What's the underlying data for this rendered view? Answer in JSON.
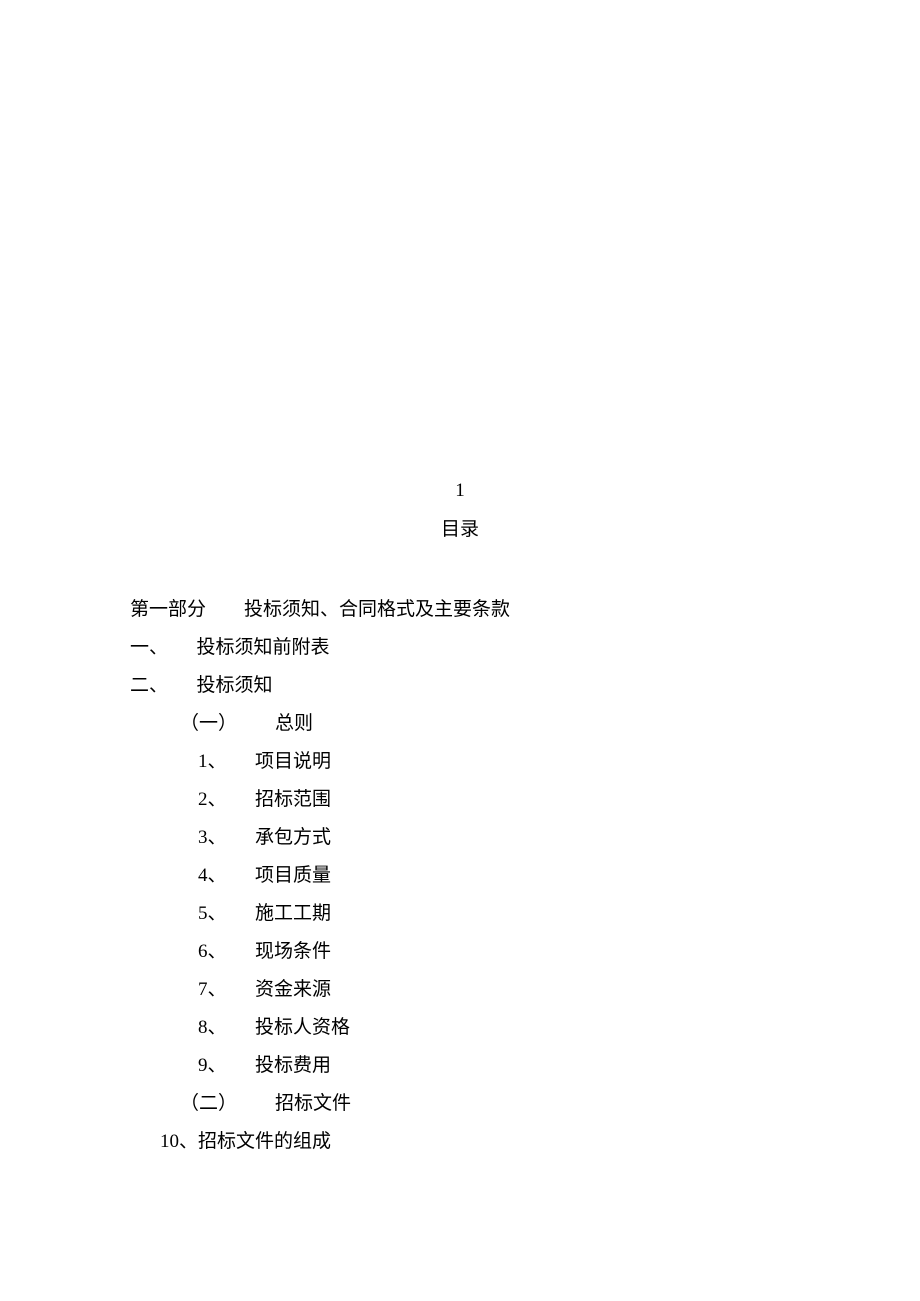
{
  "page_number": "1",
  "title": "目录",
  "toc": {
    "part1": {
      "label": "第一部分",
      "text": "投标须知、合同格式及主要条款"
    },
    "section1": {
      "label": "一、",
      "text": "投标须知前附表"
    },
    "section2": {
      "label": "二、",
      "text": "投标须知"
    },
    "sub1": {
      "label": "（一）",
      "text": "总则"
    },
    "items1": [
      {
        "num": "1、",
        "text": "项目说明"
      },
      {
        "num": "2、",
        "text": "招标范围"
      },
      {
        "num": "3、",
        "text": "承包方式"
      },
      {
        "num": "4、",
        "text": "项目质量"
      },
      {
        "num": "5、",
        "text": "施工工期"
      },
      {
        "num": "6、",
        "text": "现场条件"
      },
      {
        "num": "7、",
        "text": "资金来源"
      },
      {
        "num": "8、",
        "text": "投标人资格"
      },
      {
        "num": "9、",
        "text": "投标费用"
      }
    ],
    "sub2": {
      "label": "（二）",
      "text": "招标文件"
    },
    "item10": {
      "num": "10、",
      "text": "招标文件的组成"
    }
  }
}
